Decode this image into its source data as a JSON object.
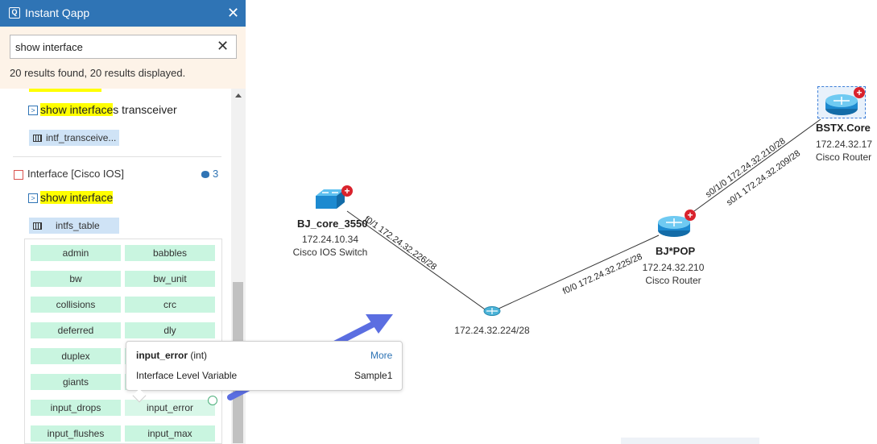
{
  "panel": {
    "title": "Instant Qapp",
    "search_value": "show interface",
    "result_count": "20 results found, 20 results displayed.",
    "first_group": {
      "command_highlight": "show interface",
      "command_rest": "s transceiver",
      "table": "intf_transceive..."
    },
    "second_group": {
      "name": "Interface [Cisco IOS]",
      "count": "3",
      "command_highlight": "show interface",
      "table": "intfs_table"
    },
    "variables": [
      "admin",
      "babbles",
      "bw",
      "bw_unit",
      "collisions",
      "crc",
      "deferred",
      "dly",
      "duplex",
      "",
      "giants",
      "",
      "input_drops",
      "input_error",
      "input_flushes",
      "input_max"
    ]
  },
  "tooltip": {
    "var_name": "input_error",
    "var_type": "(int)",
    "more": "More",
    "level": "Interface Level Variable",
    "sample": "Sample1"
  },
  "map": {
    "nodes": {
      "bj_core": {
        "name": "BJ_core_3550",
        "ip": "172.24.10.34",
        "type": "Cisco IOS Switch"
      },
      "bj_pop": {
        "name": "BJ*POP",
        "ip": "172.24.32.210",
        "type": "Cisco Router"
      },
      "bstx": {
        "name": "BSTX.Core",
        "ip": "172.24.32.17",
        "type": "Cisco Router"
      },
      "subnet": {
        "ip": "172.24.32.224/28"
      }
    },
    "links": {
      "core_if": "f0/1 172.24.32.226/28",
      "pop_if": "f0/0 172.24.32.225/28",
      "pop_bstx_a": "s0/1/0 172.24.32.210/28",
      "pop_bstx_b": "s0/1 172.24.32.209/28"
    }
  },
  "colors": {
    "title_bar": "#2f74b5",
    "highlight": "#ffff00",
    "variable_chip": "#c9f5e0",
    "arrow": "#5b6ee1"
  }
}
